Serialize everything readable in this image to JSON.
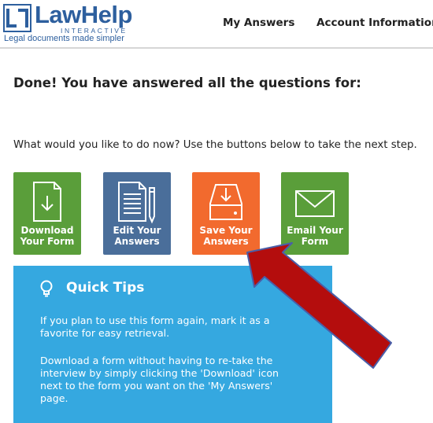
{
  "header": {
    "logo": {
      "name": "LawHelp",
      "sub": "INTERACTIVE",
      "tagline": "Legal documents made simpler"
    },
    "nav": {
      "my_answers": "My Answers",
      "account_information": "Account Information"
    }
  },
  "main": {
    "done_text": "Done! You have answered all the questions for:",
    "prompt_text": "What would you like to do now? Use the buttons below to take the next step.",
    "actions": [
      {
        "label": "Download\nYour Form",
        "icon": "download-document-icon",
        "color": "#5a9e3a"
      },
      {
        "label": "Edit Your\nAnswers",
        "icon": "edit-document-pencil-icon",
        "color": "#4a6e9a"
      },
      {
        "label": "Save Your\nAnswers",
        "icon": "save-drive-icon",
        "color": "#f26a2e"
      },
      {
        "label": "Email Your\nForm",
        "icon": "envelope-icon",
        "color": "#5a9e3a"
      }
    ]
  },
  "quick_tips": {
    "title": "Quick Tips",
    "icon": "lightbulb-icon",
    "color": "#35a8e0",
    "tips": [
      "If you plan to use this form again, mark it as a favorite for easy retrieval.",
      "Download a form without having to re-take the interview by simply clicking the 'Download' icon next to the form you want on the 'My Answers' page."
    ]
  },
  "annotation": {
    "arrow_color": "#b40d0d"
  }
}
